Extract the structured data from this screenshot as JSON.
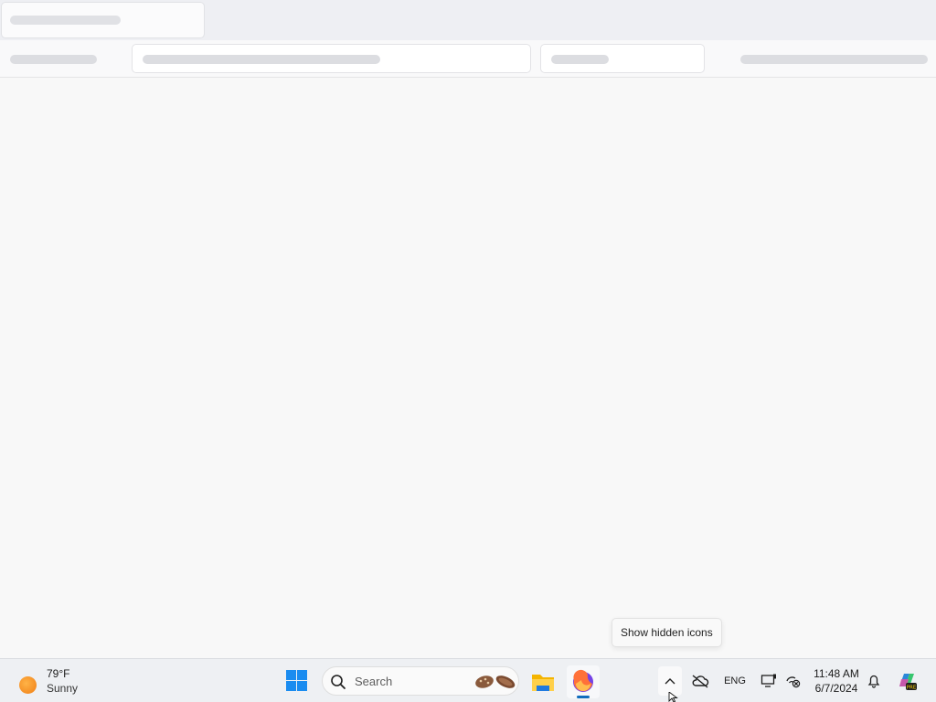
{
  "browser": {
    "tabs": [
      {
        "label": ""
      }
    ],
    "toolbar": {
      "address_placeholder": "",
      "search_placeholder": ""
    }
  },
  "tooltip": {
    "text": "Show hidden icons"
  },
  "taskbar": {
    "weather": {
      "temperature": "79°F",
      "condition": "Sunny",
      "icon": "sun-icon"
    },
    "start": {
      "icon": "windows-logo-icon"
    },
    "search": {
      "label": "Search",
      "icon": "search-icon"
    },
    "pinned": [
      {
        "name": "File Explorer",
        "icon": "folder-icon"
      },
      {
        "name": "Firefox",
        "icon": "firefox-icon",
        "running": true
      }
    ],
    "tray": {
      "language": "ENG",
      "time": "11:48 AM",
      "date": "6/7/2024"
    }
  },
  "colors": {
    "accent": "#0f6cbd",
    "windows_logo": "#1a8cf0",
    "taskbar_bg": "#eef0f3",
    "skeleton": "#dcdde1"
  }
}
